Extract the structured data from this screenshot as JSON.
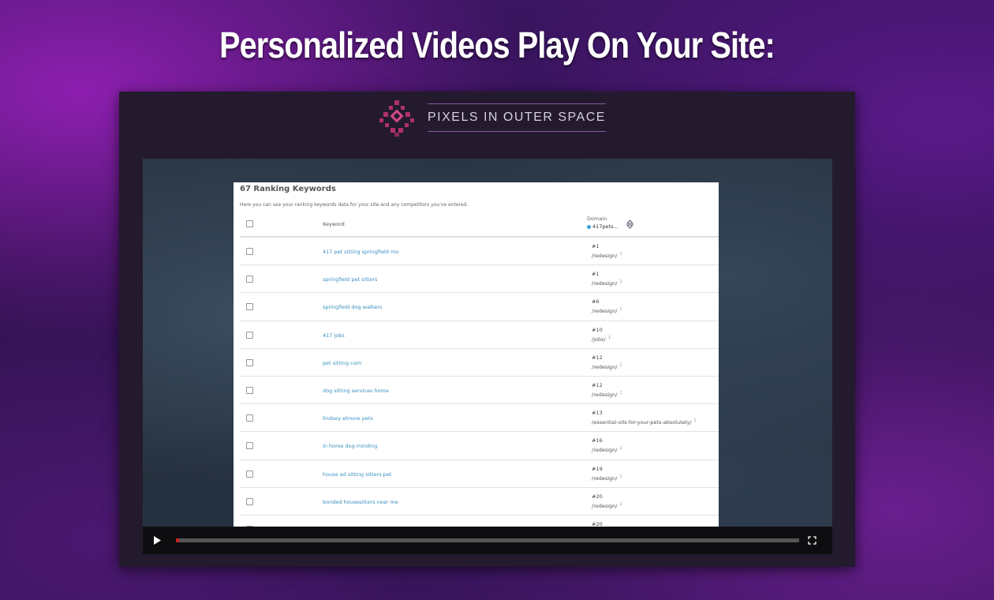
{
  "headline": "Personalized Videos Play On Your Site:",
  "brand": {
    "name": "PIXELS IN OUTER SPACE",
    "logo_icon": "diamond-pixel-logo-icon"
  },
  "panel": {
    "title": "67 Ranking Keywords",
    "subtitle": "Here you can see your ranking keywords data for your site and any competitors you've entered.",
    "columns": {
      "keyword": "Keyword",
      "domain": "Domain",
      "domain_value": "417pets..."
    },
    "rows": [
      {
        "keyword": "417 pet sitting springfield mo",
        "rank": "#1",
        "url": "/redesign/"
      },
      {
        "keyword": "springfield pet sitters",
        "rank": "#1",
        "url": "/redesign/"
      },
      {
        "keyword": "springfield dog walkers",
        "rank": "#6",
        "url": "/redesign/"
      },
      {
        "keyword": "417 jobs",
        "rank": "#10",
        "url": "/jobs/"
      },
      {
        "keyword": "pet sitting com",
        "rank": "#12",
        "url": "/redesign/"
      },
      {
        "keyword": "dog sitting services home",
        "rank": "#12",
        "url": "/redesign/"
      },
      {
        "keyword": "lindsey elmore pets",
        "rank": "#13",
        "url": "/essential-oils-for-your-pets-absolutely/"
      },
      {
        "keyword": "in home dog minding",
        "rank": "#16",
        "url": "/redesign/"
      },
      {
        "keyword": "house ad sitting sitters pet",
        "rank": "#19",
        "url": "/redesign/"
      },
      {
        "keyword": "bonded housesitters near me",
        "rank": "#20",
        "url": "/redesign/"
      },
      {
        "keyword": "",
        "rank": "#20",
        "url": ""
      }
    ],
    "link_marker": "1"
  },
  "player": {
    "progress": 0.005,
    "play_icon": "play-icon",
    "fullscreen_icon": "fullscreen-icon",
    "accent": "#c42020"
  }
}
